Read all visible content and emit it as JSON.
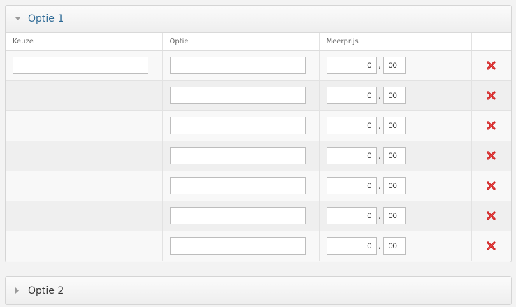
{
  "panels": [
    {
      "title": "Optie 1",
      "expanded": true
    },
    {
      "title": "Optie 2",
      "expanded": false
    }
  ],
  "table": {
    "columns": [
      "Keuze",
      "Optie",
      "Meerprijs",
      ""
    ],
    "rows": [
      {
        "keuze": "",
        "optie": "",
        "price_whole": "0",
        "price_cents": "00"
      },
      {
        "optie": "",
        "price_whole": "0",
        "price_cents": "00"
      },
      {
        "optie": "",
        "price_whole": "0",
        "price_cents": "00"
      },
      {
        "optie": "",
        "price_whole": "0",
        "price_cents": "00"
      },
      {
        "optie": "",
        "price_whole": "0",
        "price_cents": "00"
      },
      {
        "optie": "",
        "price_whole": "0",
        "price_cents": "00"
      },
      {
        "optie": "",
        "price_whole": "0",
        "price_cents": "00"
      }
    ],
    "decimal_separator": ","
  },
  "icons": {
    "expanded": "caret-down-icon",
    "collapsed": "caret-right-icon",
    "delete": "delete-x-icon"
  },
  "colors": {
    "title_active": "#2e6a96",
    "delete_red": "#d42020"
  }
}
